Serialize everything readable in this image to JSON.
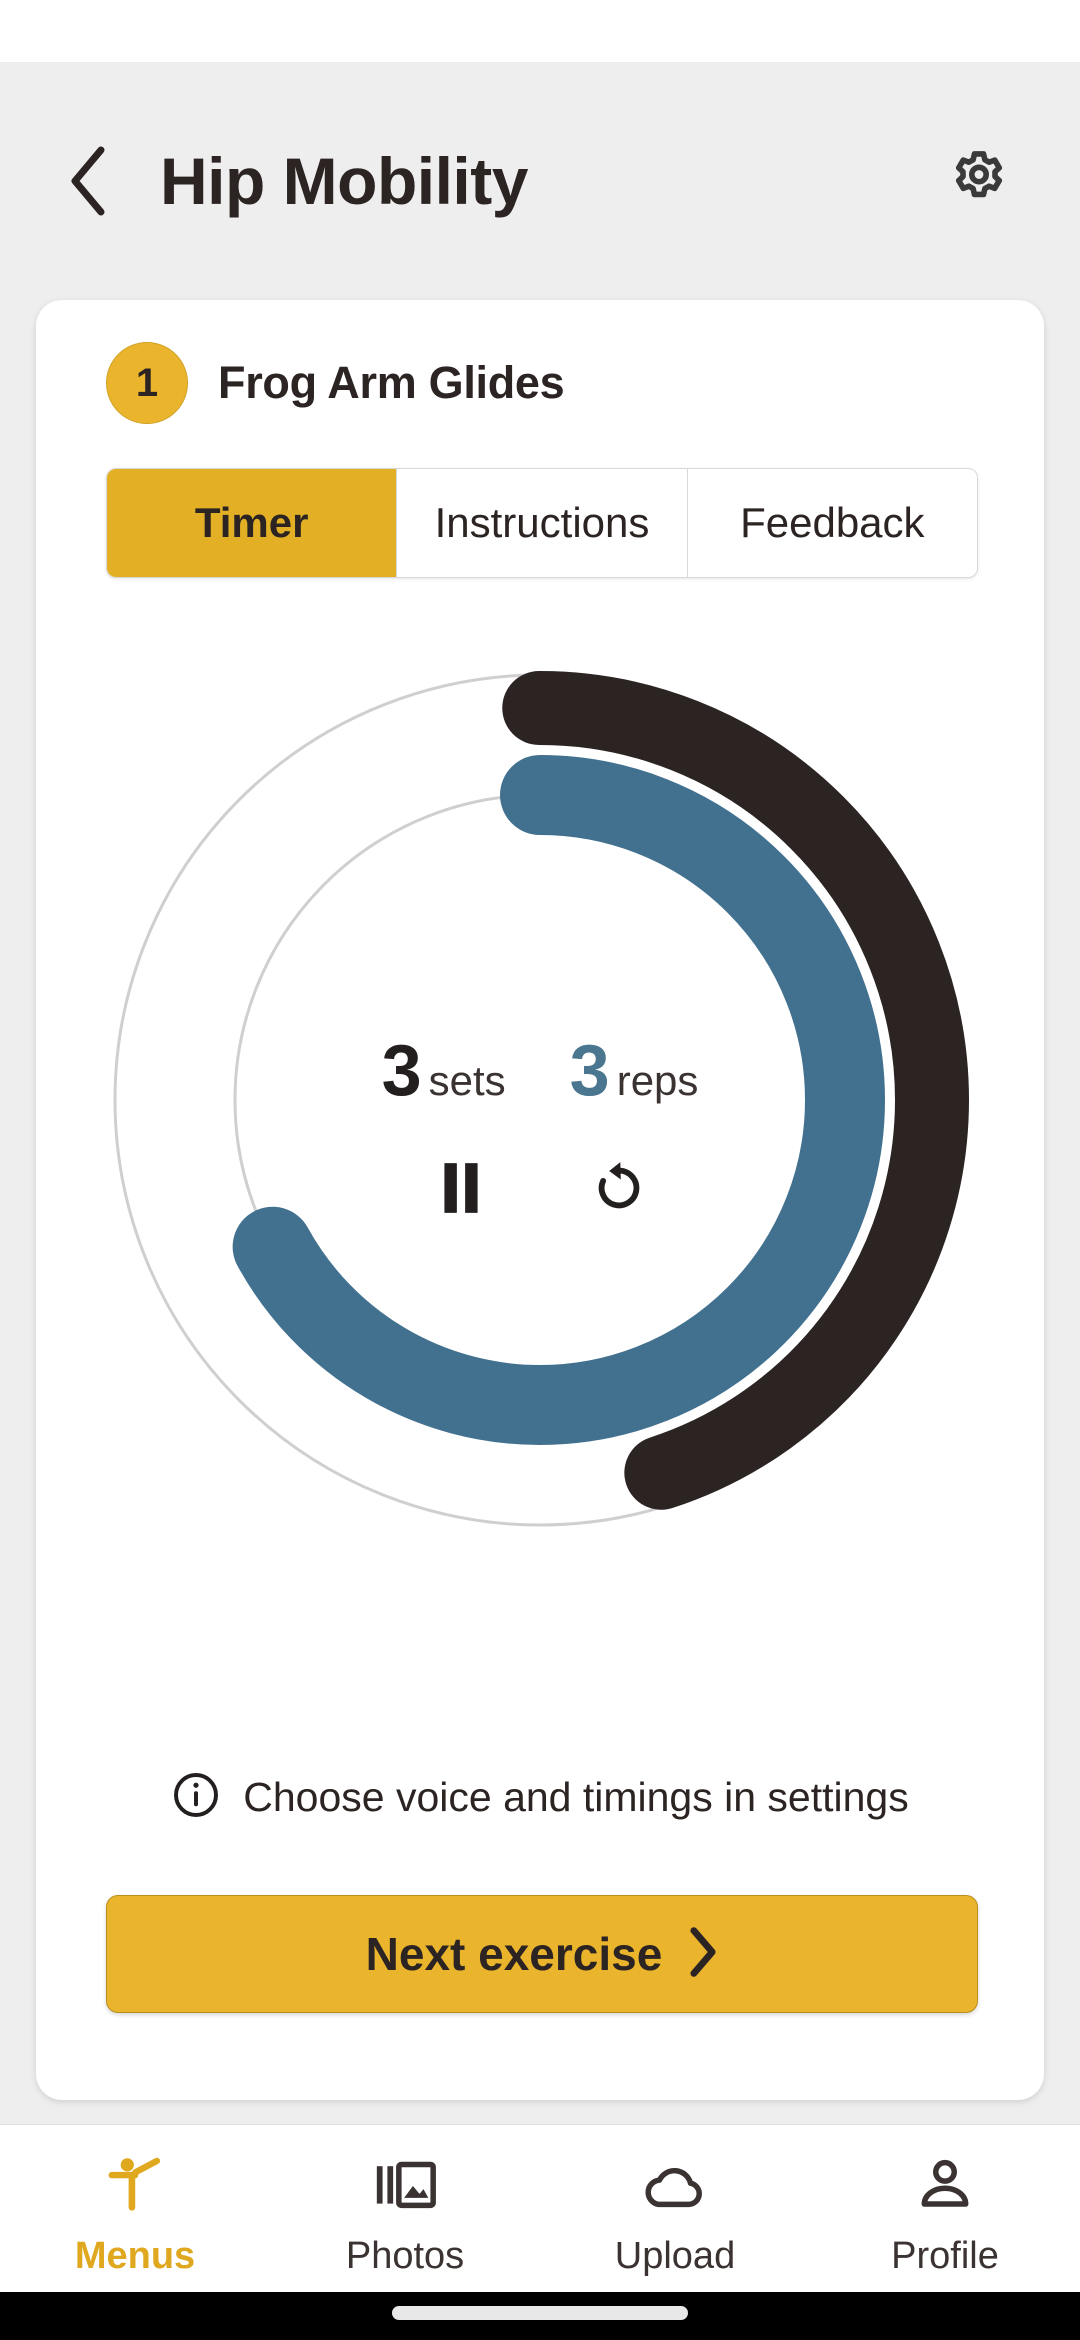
{
  "header": {
    "title": "Hip Mobility",
    "back_icon": "chevron-left-icon",
    "settings_icon": "gear-icon"
  },
  "exercise": {
    "number": "1",
    "name": "Frog Arm Glides"
  },
  "tabs": [
    {
      "label": "Timer",
      "active": true
    },
    {
      "label": "Instructions",
      "active": false
    },
    {
      "label": "Feedback",
      "active": false
    }
  ],
  "timer": {
    "sets_value": "3",
    "sets_label": "sets",
    "reps_value": "3",
    "reps_label": "reps",
    "pause_icon": "pause-icon",
    "reset_icon": "restart-icon",
    "outer_arc_color": "#2b2422",
    "inner_arc_color": "#427190",
    "track_color": "#cfcfcf",
    "outer_arc_percent": 45,
    "inner_arc_percent": 67
  },
  "hint": {
    "icon": "info-circle-icon",
    "text": "Choose voice and timings in settings"
  },
  "cta": {
    "label": "Next exercise",
    "icon": "chevron-right-icon"
  },
  "bottom_nav": [
    {
      "label": "Menus",
      "icon": "stretching-figure-icon",
      "active": true
    },
    {
      "label": "Photos",
      "icon": "gallery-icon",
      "active": false
    },
    {
      "label": "Upload",
      "icon": "cloud-icon",
      "active": false
    },
    {
      "label": "Profile",
      "icon": "person-icon",
      "active": false
    }
  ],
  "colors": {
    "accent": "#eab52c",
    "tab_active": "#e3b025",
    "dark": "#2b2422",
    "blue": "#427190",
    "page_bg": "#efeeee"
  }
}
